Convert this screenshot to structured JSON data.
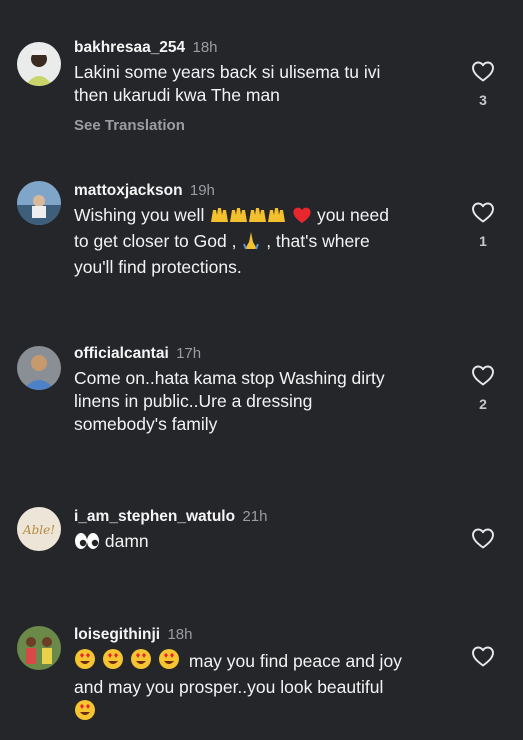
{
  "comments": [
    {
      "username": "bakhresaa_254",
      "time": "18h",
      "text_lines": [
        "Lakini some years back si ulisema tu ivi",
        "then ukarudi kwa The man"
      ],
      "translate_label": "See Translation",
      "likes": "3"
    },
    {
      "username": "mattoxjackson",
      "time": "19h",
      "line1_pre": "Wishing you well",
      "line1_post": "you need",
      "line2_pre": "to get closer to God ,",
      "line2_post": ", that's where",
      "line3": "you'll find protections.",
      "likes": "1"
    },
    {
      "username": "officialcantai",
      "time": "17h",
      "text_lines": [
        "Come on..hata kama stop Washing dirty",
        "linens in public..Ure a dressing",
        "somebody's family"
      ],
      "likes": "2"
    },
    {
      "username": "i_am_stephen_watulo",
      "time": "21h",
      "text": "damn",
      "avatar_text": "Able!"
    },
    {
      "username": "loisegithinji",
      "time": "18h",
      "line1_post": "may you find peace and joy",
      "line2": "and may you prosper..you look beautiful"
    }
  ],
  "colors": {
    "background": "#25262a",
    "primary_text": "#f3f3f3",
    "secondary_text": "#9b9ca1"
  },
  "icons": [
    "heart-outline-icon",
    "raising-hands-emoji",
    "red-heart-emoji",
    "praying-hands-emoji",
    "eyes-emoji",
    "heart-eyes-emoji"
  ]
}
